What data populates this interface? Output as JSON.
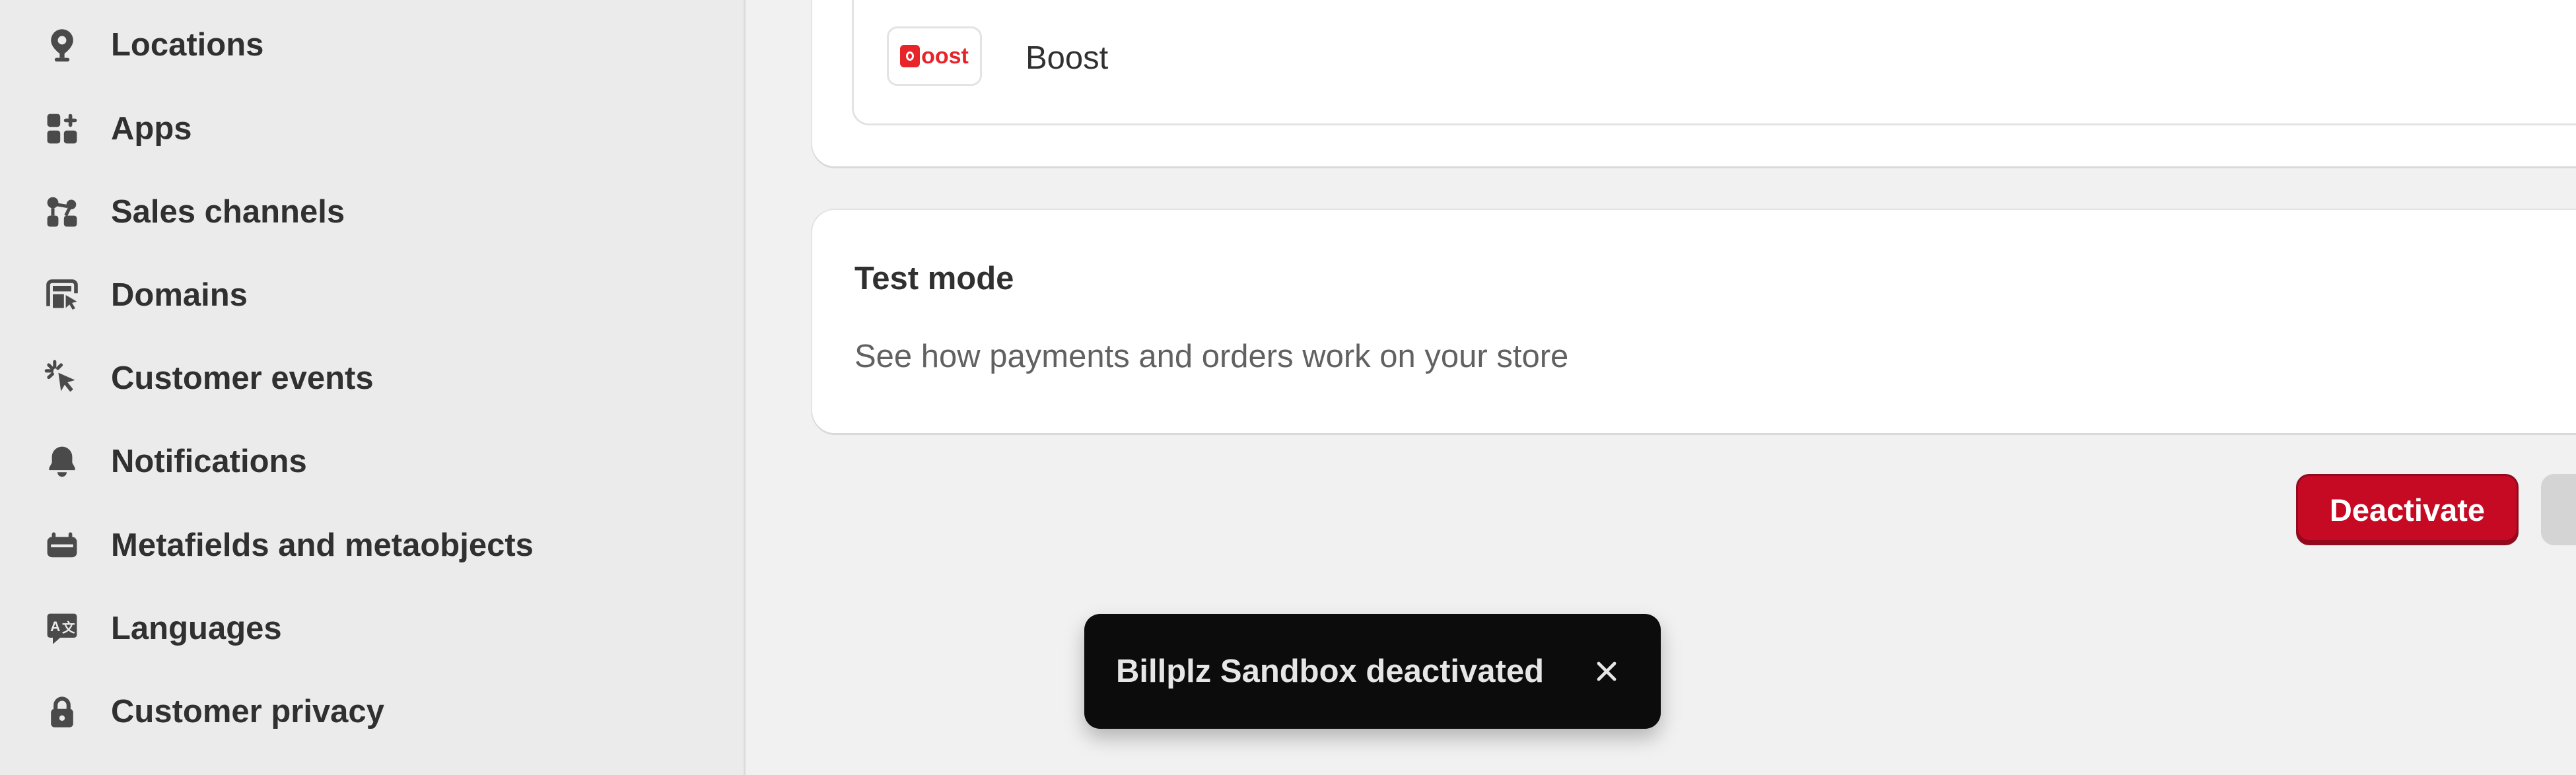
{
  "sidebar": {
    "items": [
      {
        "label": "Locations",
        "icon": "location-pin-icon"
      },
      {
        "label": "Apps",
        "icon": "apps-grid-icon"
      },
      {
        "label": "Sales channels",
        "icon": "sales-channels-icon"
      },
      {
        "label": "Domains",
        "icon": "domains-icon"
      },
      {
        "label": "Customer events",
        "icon": "cursor-click-icon"
      },
      {
        "label": "Notifications",
        "icon": "bell-icon"
      },
      {
        "label": "Metafields and metaobjects",
        "icon": "metafields-icon"
      },
      {
        "label": "Languages",
        "icon": "translate-icon"
      },
      {
        "label": "Customer privacy",
        "icon": "lock-icon"
      }
    ]
  },
  "providers": {
    "boost": {
      "logo_text": "oost",
      "name": "Boost",
      "enabled": true
    }
  },
  "test_mode": {
    "title": "Test mode",
    "description": "See how payments and orders work on your store",
    "enabled": false
  },
  "actions": {
    "deactivate_label": "Deactivate"
  },
  "toast": {
    "message": "Billplz Sandbox deactivated",
    "close_icon": "close-icon"
  },
  "colors": {
    "sidebar_bg": "#ebebeb",
    "page_bg": "#f1f1f1",
    "critical": "#c70a24",
    "toast_bg": "#0c0c0c",
    "boost_brand": "#e8232a"
  }
}
